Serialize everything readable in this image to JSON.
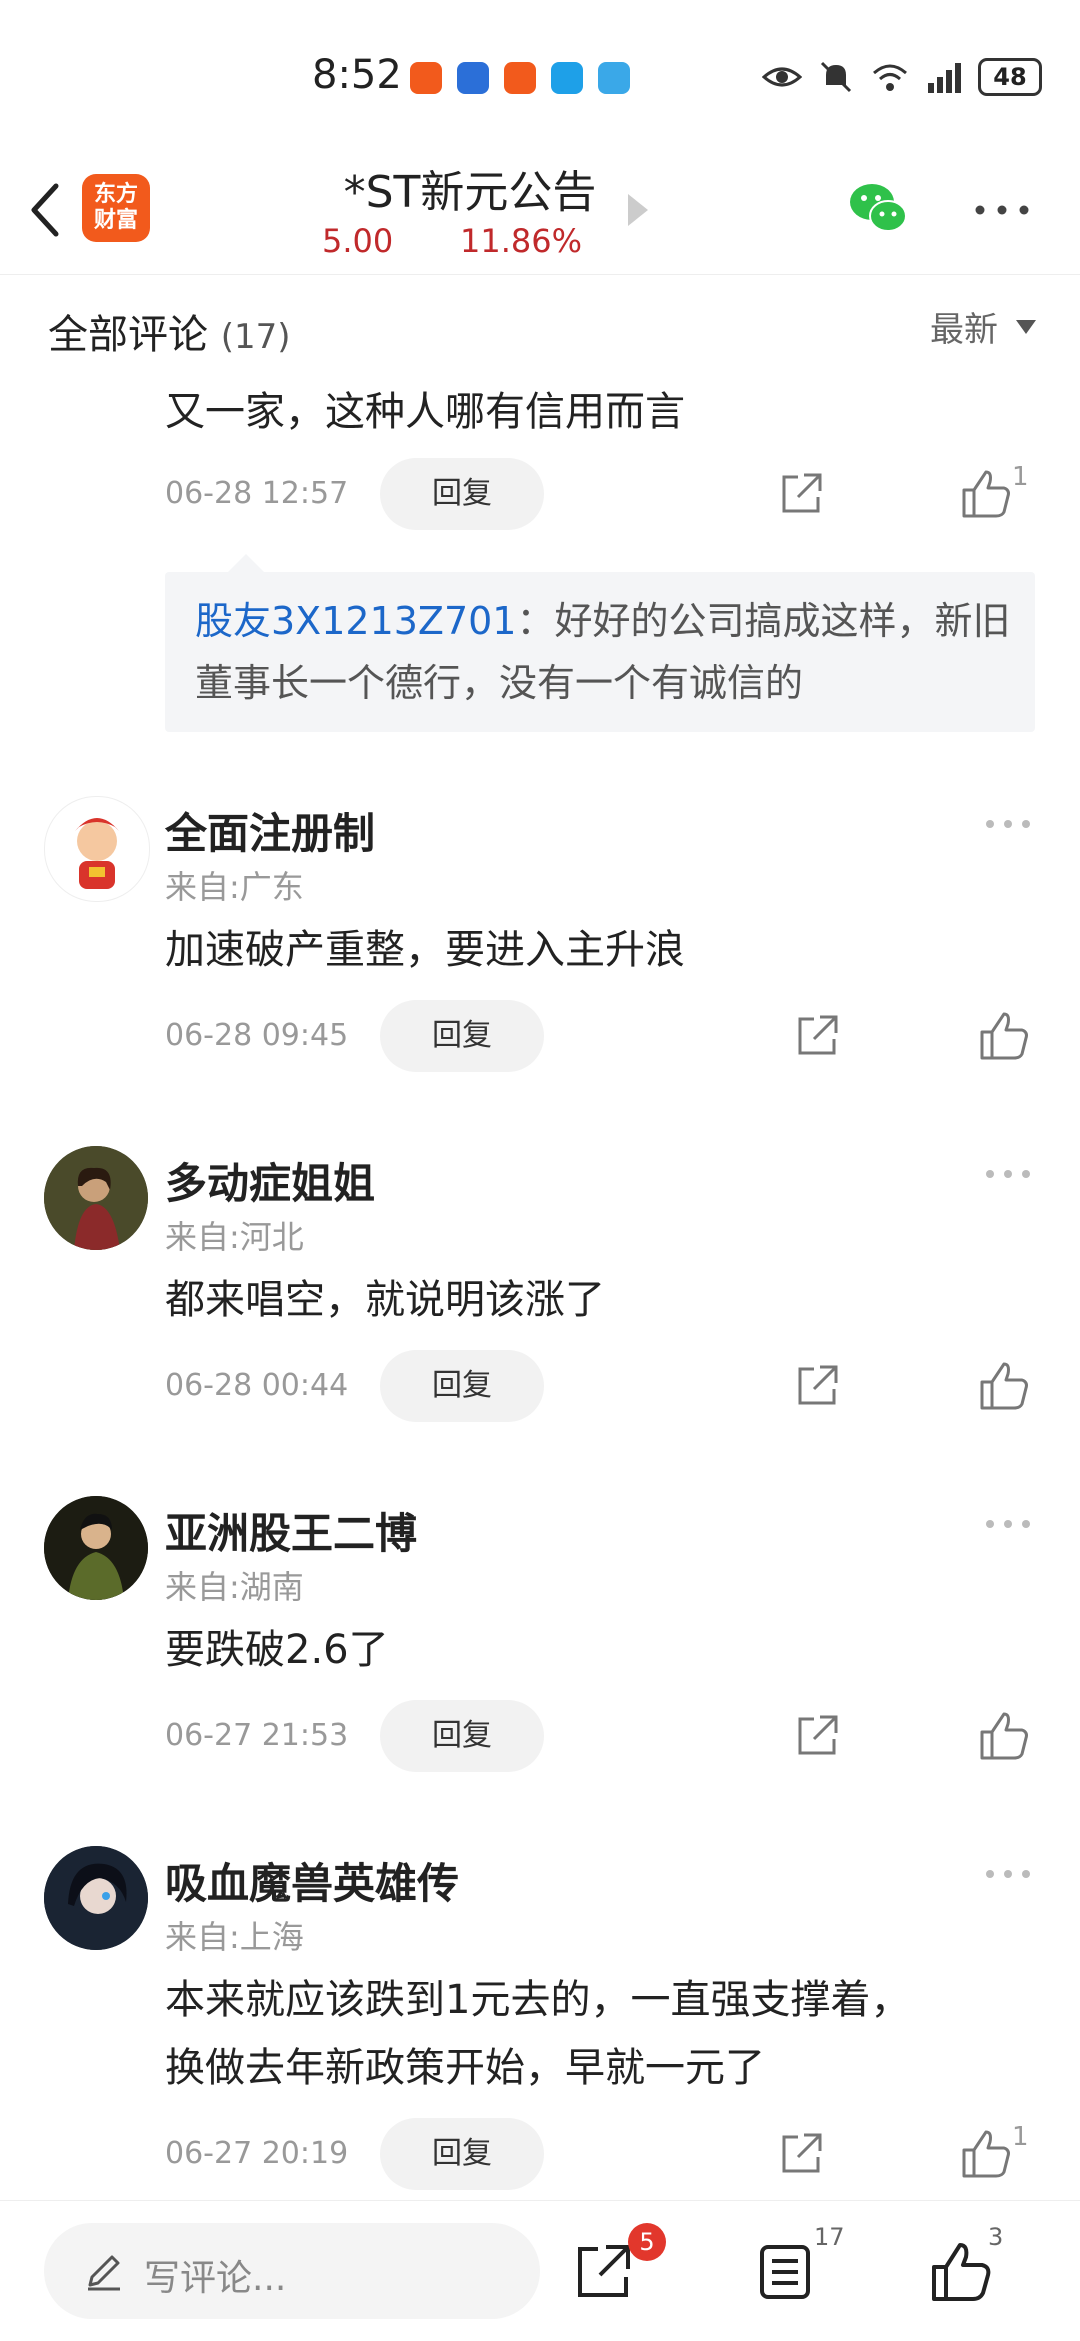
{
  "status_bar": {
    "time": "8:52",
    "battery": "48"
  },
  "header": {
    "logo_line1": "东方",
    "logo_line2": "财富",
    "title": "*ST新元公告",
    "price": "5.00",
    "change_pct": "11.86%"
  },
  "comments_header": {
    "title": "全部评论",
    "count": "(17)",
    "sort": "最新"
  },
  "top_comment": {
    "text": "又一家，这种人哪有信用而言",
    "time": "06-28 12:57",
    "reply": "回复",
    "likes": "1",
    "quote_user": "股友3X1213Z701",
    "quote_sep": "：",
    "quote_text": "好好的公司搞成这样，新旧董事长一个德行，没有一个有诚信的"
  },
  "comments": [
    {
      "name": "全面注册制",
      "location": "来自:广东",
      "text": "加速破产重整，要进入主升浪",
      "time": "06-28 09:45",
      "reply": "回复",
      "likes": ""
    },
    {
      "name": "多动症姐姐",
      "location": "来自:河北",
      "text": "都来唱空，就说明该涨了",
      "time": "06-28 00:44",
      "reply": "回复",
      "likes": ""
    },
    {
      "name": "亚洲股王二博",
      "location": "来自:湖南",
      "text": "要跌破2.6了",
      "time": "06-27 21:53",
      "reply": "回复",
      "likes": ""
    },
    {
      "name": "吸血魔兽英雄传",
      "location": "来自:上海",
      "text_line1": "本来就应该跌到1元去的，一直强支撑着，",
      "text_line2": "换做去年新政策开始，早就一元了",
      "time": "06-27 20:19",
      "reply": "回复",
      "likes": "1"
    }
  ],
  "bottom_bar": {
    "placeholder": "写评论...",
    "share_badge": "5",
    "comment_count": "17",
    "like_count": "3"
  },
  "colors": {
    "accent_red": "#c0292b",
    "link_blue": "#1c67c9",
    "brand_orange": "#f25a1c"
  }
}
